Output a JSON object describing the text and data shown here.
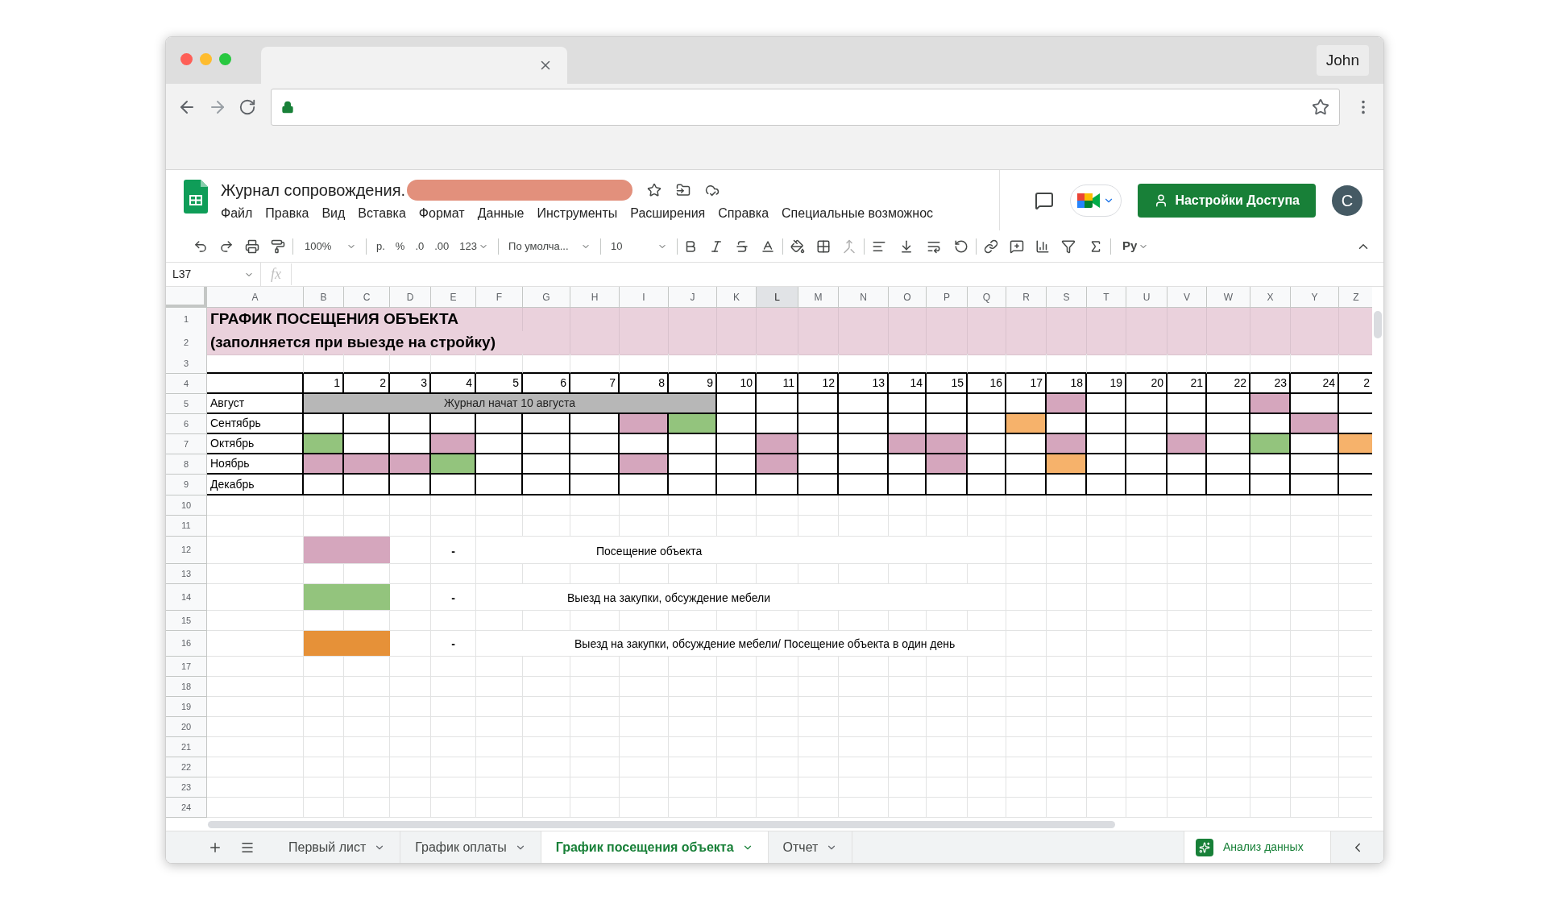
{
  "browser": {
    "profile": "John"
  },
  "app": {
    "title": "Журнал сопровождения.",
    "menu": [
      "Файл",
      "Правка",
      "Вид",
      "Вставка",
      "Формат",
      "Данные",
      "Инструменты",
      "Расширения",
      "Справка",
      "Специальные возможнос"
    ],
    "share_button": "Настройки Доступа",
    "avatar": "C"
  },
  "toolbar": {
    "zoom": "100%",
    "currency": "р.",
    "percent": "%",
    "decrease_decimals": ".0",
    "increase_decimals": ".00",
    "number_format": "123",
    "font": "По умолча...",
    "font_size": "10",
    "input_tools": "Pу"
  },
  "formula_bar": {
    "cell": "L37",
    "fx": "fx"
  },
  "sheet": {
    "columns": [
      {
        "letter": "A",
        "selected": false
      },
      {
        "letter": "B",
        "selected": false
      },
      {
        "letter": "C",
        "selected": false
      },
      {
        "letter": "D",
        "selected": false
      },
      {
        "letter": "E",
        "selected": false
      },
      {
        "letter": "F",
        "selected": false
      },
      {
        "letter": "G",
        "selected": false
      },
      {
        "letter": "H",
        "selected": false
      },
      {
        "letter": "I",
        "selected": false
      },
      {
        "letter": "J",
        "selected": false
      },
      {
        "letter": "K",
        "selected": false
      },
      {
        "letter": "L",
        "selected": true
      },
      {
        "letter": "M",
        "selected": false
      },
      {
        "letter": "N",
        "selected": false
      },
      {
        "letter": "O",
        "selected": false
      },
      {
        "letter": "P",
        "selected": false
      },
      {
        "letter": "Q",
        "selected": false
      },
      {
        "letter": "R",
        "selected": false
      },
      {
        "letter": "S",
        "selected": false
      },
      {
        "letter": "T",
        "selected": false
      },
      {
        "letter": "U",
        "selected": false
      },
      {
        "letter": "V",
        "selected": false
      },
      {
        "letter": "W",
        "selected": false
      },
      {
        "letter": "X",
        "selected": false
      },
      {
        "letter": "Y",
        "selected": false
      },
      {
        "letter": "Z",
        "selected": false
      }
    ],
    "row_numbers": [
      "1",
      "2",
      "3",
      "4",
      "5",
      "6",
      "7",
      "8",
      "9",
      "10",
      "11",
      "12",
      "13",
      "14",
      "15",
      "16",
      "17",
      "18",
      "19",
      "20",
      "21",
      "22",
      "23",
      "24"
    ],
    "title_lines": [
      "ГРАФИК ПОСЕЩЕНИЯ ОБЪЕКТА",
      "(заполняется при выезде на стройку)"
    ],
    "days": [
      "1",
      "2",
      "3",
      "4",
      "5",
      "6",
      "7",
      "8",
      "9",
      "10",
      "11",
      "12",
      "13",
      "14",
      "15",
      "16",
      "17",
      "18",
      "19",
      "20",
      "21",
      "22",
      "23",
      "24",
      "2"
    ],
    "months": [
      {
        "name": "Август",
        "banner": "Журнал начат 10 августа",
        "cells": [
          {
            "color": "#ffffff"
          },
          {
            "color": "#ffffff"
          },
          {
            "color": "#ffffff"
          },
          {
            "color": "#ffffff"
          },
          {
            "color": "#ffffff"
          },
          {
            "color": "#ffffff"
          },
          {
            "color": "#ffffff"
          },
          {
            "color": "#ffffff"
          },
          {
            "color": "#d5a6bd"
          },
          {
            "color": "#ffffff"
          },
          {
            "color": "#ffffff"
          },
          {
            "color": "#ffffff"
          },
          {
            "color": "#ffffff"
          },
          {
            "color": "#d5a6bd"
          },
          {
            "color": "#ffffff"
          },
          {
            "color": "#ffffff"
          }
        ]
      },
      {
        "name": "Сентябрь",
        "cells": [
          {
            "color": "#ffffff"
          },
          {
            "color": "#ffffff"
          },
          {
            "color": "#ffffff"
          },
          {
            "color": "#ffffff"
          },
          {
            "color": "#ffffff"
          },
          {
            "color": "#ffffff"
          },
          {
            "color": "#ffffff"
          },
          {
            "color": "#d5a6bd"
          },
          {
            "color": "#93c47d"
          },
          {
            "color": "#ffffff"
          },
          {
            "color": "#ffffff"
          },
          {
            "color": "#ffffff"
          },
          {
            "color": "#ffffff"
          },
          {
            "color": "#ffffff"
          },
          {
            "color": "#ffffff"
          },
          {
            "color": "#ffffff"
          },
          {
            "color": "#f6b26b"
          },
          {
            "color": "#ffffff"
          },
          {
            "color": "#ffffff"
          },
          {
            "color": "#ffffff"
          },
          {
            "color": "#ffffff"
          },
          {
            "color": "#ffffff"
          },
          {
            "color": "#ffffff"
          },
          {
            "color": "#d5a6bd"
          },
          {
            "color": "#ffffff"
          }
        ]
      },
      {
        "name": "Октябрь",
        "cells": [
          {
            "color": "#93c47d"
          },
          {
            "color": "#ffffff"
          },
          {
            "color": "#ffffff"
          },
          {
            "color": "#d5a6bd"
          },
          {
            "color": "#ffffff"
          },
          {
            "color": "#ffffff"
          },
          {
            "color": "#ffffff"
          },
          {
            "color": "#ffffff"
          },
          {
            "color": "#ffffff"
          },
          {
            "color": "#ffffff"
          },
          {
            "color": "#d5a6bd"
          },
          {
            "color": "#ffffff"
          },
          {
            "color": "#ffffff"
          },
          {
            "color": "#d5a6bd"
          },
          {
            "color": "#d5a6bd"
          },
          {
            "color": "#ffffff"
          },
          {
            "color": "#ffffff"
          },
          {
            "color": "#d5a6bd"
          },
          {
            "color": "#ffffff"
          },
          {
            "color": "#ffffff"
          },
          {
            "color": "#d5a6bd"
          },
          {
            "color": "#ffffff"
          },
          {
            "color": "#93c47d"
          },
          {
            "color": "#ffffff"
          },
          {
            "color": "#f6b26b"
          }
        ]
      },
      {
        "name": "Ноябрь",
        "cells": [
          {
            "color": "#d5a6bd"
          },
          {
            "color": "#d5a6bd"
          },
          {
            "color": "#d5a6bd"
          },
          {
            "color": "#93c47d"
          },
          {
            "color": "#ffffff"
          },
          {
            "color": "#ffffff"
          },
          {
            "color": "#ffffff"
          },
          {
            "color": "#d5a6bd"
          },
          {
            "color": "#ffffff"
          },
          {
            "color": "#ffffff"
          },
          {
            "color": "#d5a6bd"
          },
          {
            "color": "#ffffff"
          },
          {
            "color": "#ffffff"
          },
          {
            "color": "#ffffff"
          },
          {
            "color": "#d5a6bd"
          },
          {
            "color": "#ffffff"
          },
          {
            "color": "#ffffff"
          },
          {
            "color": "#f6b26b"
          },
          {
            "color": "#ffffff"
          },
          {
            "color": "#ffffff"
          },
          {
            "color": "#ffffff"
          },
          {
            "color": "#ffffff"
          },
          {
            "color": "#ffffff"
          },
          {
            "color": "#ffffff"
          },
          {
            "color": "#ffffff"
          }
        ]
      },
      {
        "name": "Декабрь",
        "cells": [
          {
            "color": "#ffffff"
          },
          {
            "color": "#ffffff"
          },
          {
            "color": "#ffffff"
          },
          {
            "color": "#ffffff"
          },
          {
            "color": "#ffffff"
          },
          {
            "color": "#ffffff"
          },
          {
            "color": "#ffffff"
          },
          {
            "color": "#ffffff"
          },
          {
            "color": "#ffffff"
          },
          {
            "color": "#ffffff"
          },
          {
            "color": "#ffffff"
          },
          {
            "color": "#ffffff"
          },
          {
            "color": "#ffffff"
          },
          {
            "color": "#ffffff"
          },
          {
            "color": "#ffffff"
          },
          {
            "color": "#ffffff"
          },
          {
            "color": "#ffffff"
          },
          {
            "color": "#ffffff"
          },
          {
            "color": "#ffffff"
          },
          {
            "color": "#ffffff"
          },
          {
            "color": "#ffffff"
          },
          {
            "color": "#ffffff"
          },
          {
            "color": "#ffffff"
          },
          {
            "color": "#ffffff"
          },
          {
            "color": "#ffffff"
          }
        ]
      }
    ],
    "legend": [
      {
        "color": "#d5a6bd",
        "dash": "-",
        "text": "Посещение объекта"
      },
      {
        "color": "#93c47d",
        "dash": "-",
        "text": "Выезд на закупки, обсуждение мебели"
      },
      {
        "color": "#e69138",
        "dash": "-",
        "text": "Выезд на закупки, обсуждение мебели/ Посещение объекта в один день"
      }
    ]
  },
  "sheet_tabs": [
    {
      "label": "Первый лист",
      "selected": false
    },
    {
      "label": "График оплаты",
      "selected": false
    },
    {
      "label": "График посещения объекта",
      "selected": true
    },
    {
      "label": "Отчет",
      "selected": false
    }
  ],
  "explore_button": "Анализ данных"
}
